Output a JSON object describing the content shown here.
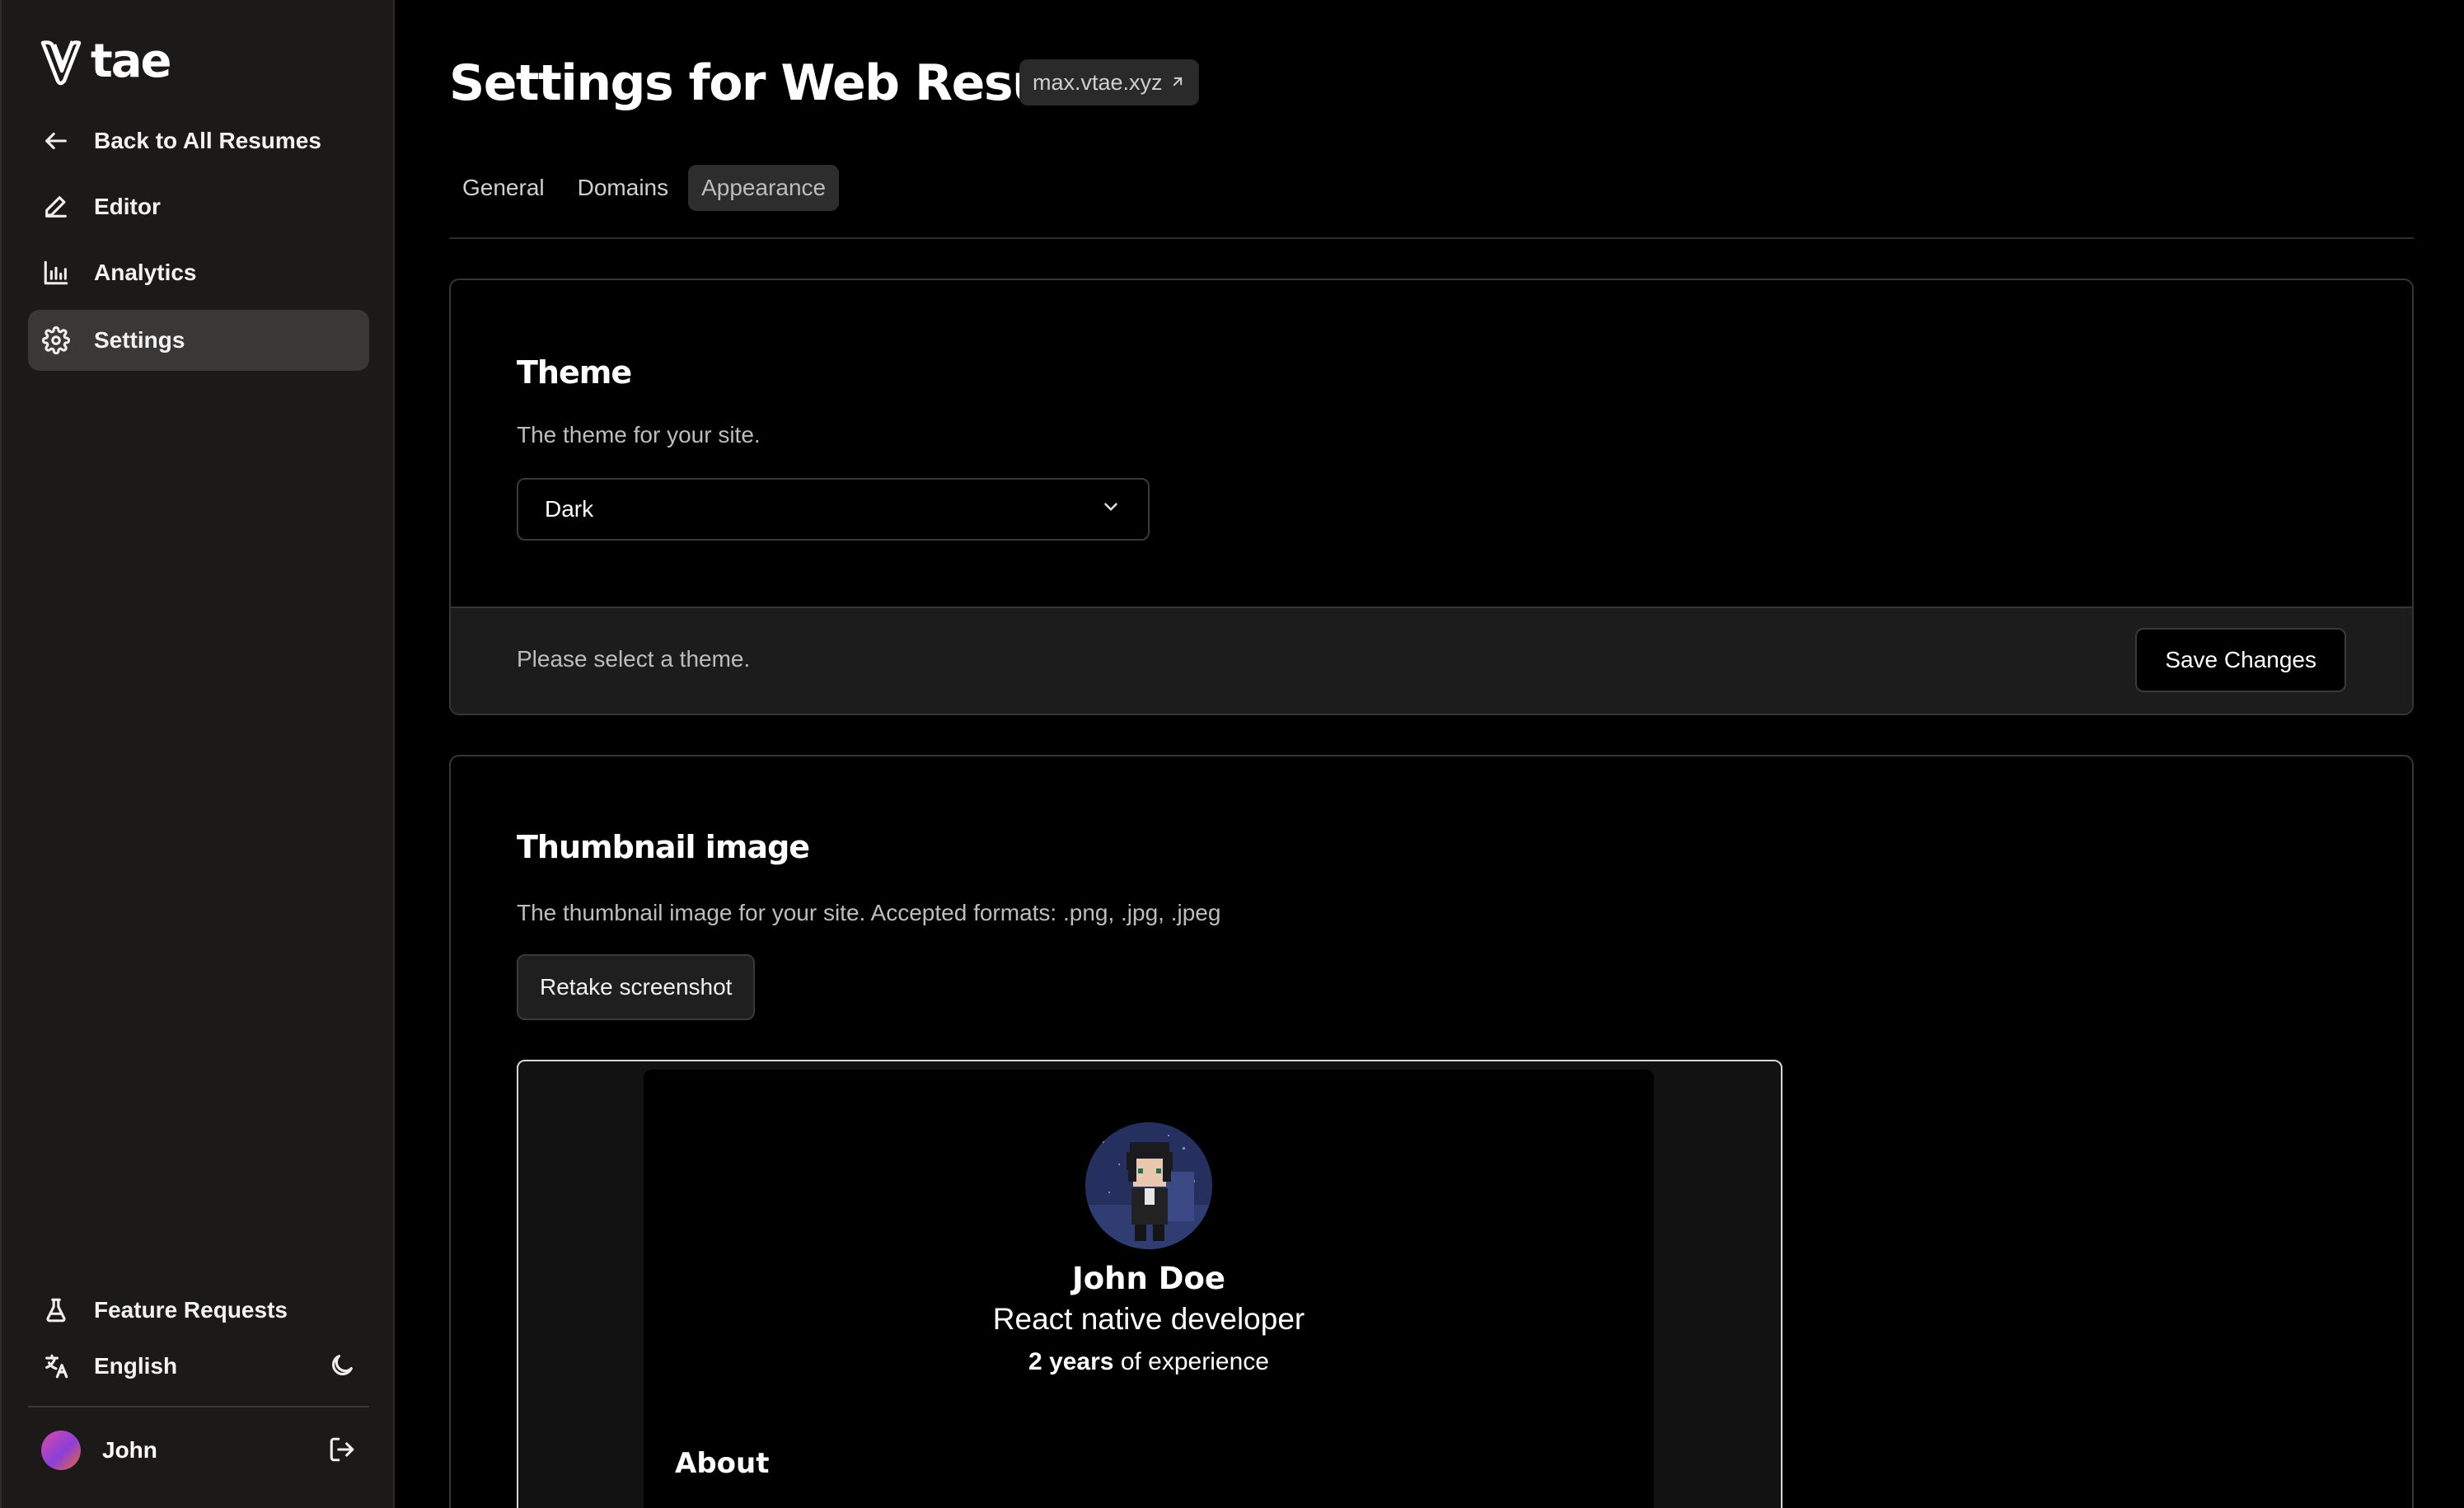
{
  "brand": {
    "wordmark": "tae"
  },
  "sidebar": {
    "items": [
      {
        "label": "Back to All Resumes",
        "icon": "arrow-left-icon"
      },
      {
        "label": "Editor",
        "icon": "pencil-icon"
      },
      {
        "label": "Analytics",
        "icon": "bar-chart-icon"
      },
      {
        "label": "Settings",
        "icon": "gear-icon",
        "active": true
      }
    ],
    "bottom": {
      "feature_requests": "Feature Requests",
      "language": "English",
      "user_name": "John"
    }
  },
  "header": {
    "title": "Settings for Web Resume",
    "domain": "max.vtae.xyz"
  },
  "tabs": [
    {
      "label": "General"
    },
    {
      "label": "Domains"
    },
    {
      "label": "Appearance",
      "active": true
    }
  ],
  "theme_card": {
    "title": "Theme",
    "description": "The theme for your site.",
    "selected": "Dark",
    "footer_note": "Please select a theme.",
    "save_label": "Save Changes"
  },
  "thumbnail_card": {
    "title": "Thumbnail image",
    "description": "The thumbnail image for your site. Accepted formats: .png, .jpg, .jpeg",
    "retake_label": "Retake screenshot",
    "preview": {
      "name": "John Doe",
      "role": "React native developer",
      "experience_bold": "2 years",
      "experience_rest": " of experience",
      "section": "About"
    }
  },
  "colors": {
    "background": "#000000",
    "sidebar": "#1c1a19",
    "active_item": "#3a3837"
  }
}
